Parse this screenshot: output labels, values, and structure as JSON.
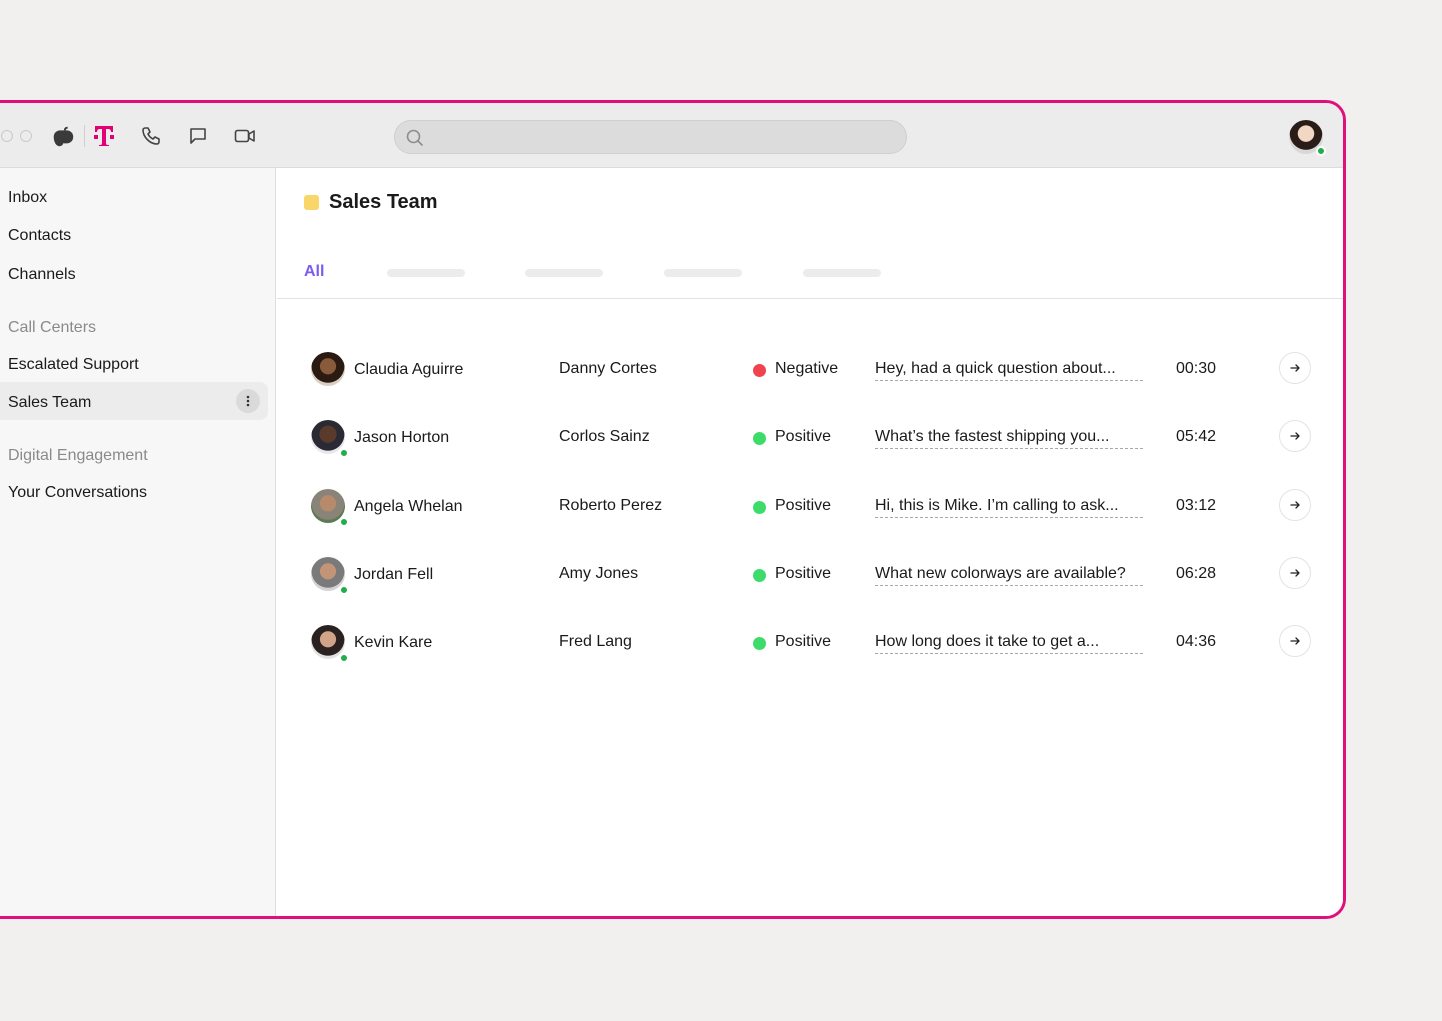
{
  "window": {
    "border_color": "#e0107a",
    "toolbar": {
      "icons": [
        "dialpad-logo-icon",
        "t-mobile-logo-icon",
        "phone-icon",
        "chat-icon",
        "video-icon"
      ],
      "search": {
        "placeholder": "",
        "value": ""
      },
      "user_status_color": "#1fae4b"
    }
  },
  "sidebar": {
    "items": [
      {
        "label": "Inbox"
      },
      {
        "label": "Contacts"
      },
      {
        "label": "Channels"
      }
    ],
    "sections": [
      {
        "heading": "Call Centers",
        "items": [
          {
            "label": "Escalated Support"
          },
          {
            "label": "Sales Team",
            "active": true
          }
        ]
      },
      {
        "heading": "Digital Engagement",
        "items": [
          {
            "label": "Your Conversations"
          }
        ]
      }
    ]
  },
  "main": {
    "title": "Sales Team",
    "title_color": "#f8d66a",
    "tabs": [
      {
        "label": "All",
        "active": true
      }
    ],
    "accent_color": "#7b5cf0",
    "rows": [
      {
        "agent": "Claudia Aguirre",
        "customer": "Danny Cortes",
        "sentiment": "Negative",
        "sentiment_color": "#f0434d",
        "message": "Hey, had a quick question about...",
        "duration": "00:30",
        "online": false
      },
      {
        "agent": "Jason Horton",
        "customer": "Corlos Sainz",
        "sentiment": "Positive",
        "sentiment_color": "#3ddc6a",
        "message": "What’s the fastest shipping you...",
        "duration": "05:42",
        "online": true
      },
      {
        "agent": "Angela Whelan",
        "customer": "Roberto Perez",
        "sentiment": "Positive",
        "sentiment_color": "#3ddc6a",
        "message": "Hi, this is Mike. I’m calling to ask...",
        "duration": "03:12",
        "online": true
      },
      {
        "agent": "Jordan Fell",
        "customer": "Amy Jones",
        "sentiment": "Positive",
        "sentiment_color": "#3ddc6a",
        "message": "What new colorways are available?",
        "duration": "06:28",
        "online": true
      },
      {
        "agent": "Kevin Kare",
        "customer": "Fred Lang",
        "sentiment": "Positive",
        "sentiment_color": "#3ddc6a",
        "message": "How long does it take to get a...",
        "duration": "04:36",
        "online": true
      }
    ]
  }
}
